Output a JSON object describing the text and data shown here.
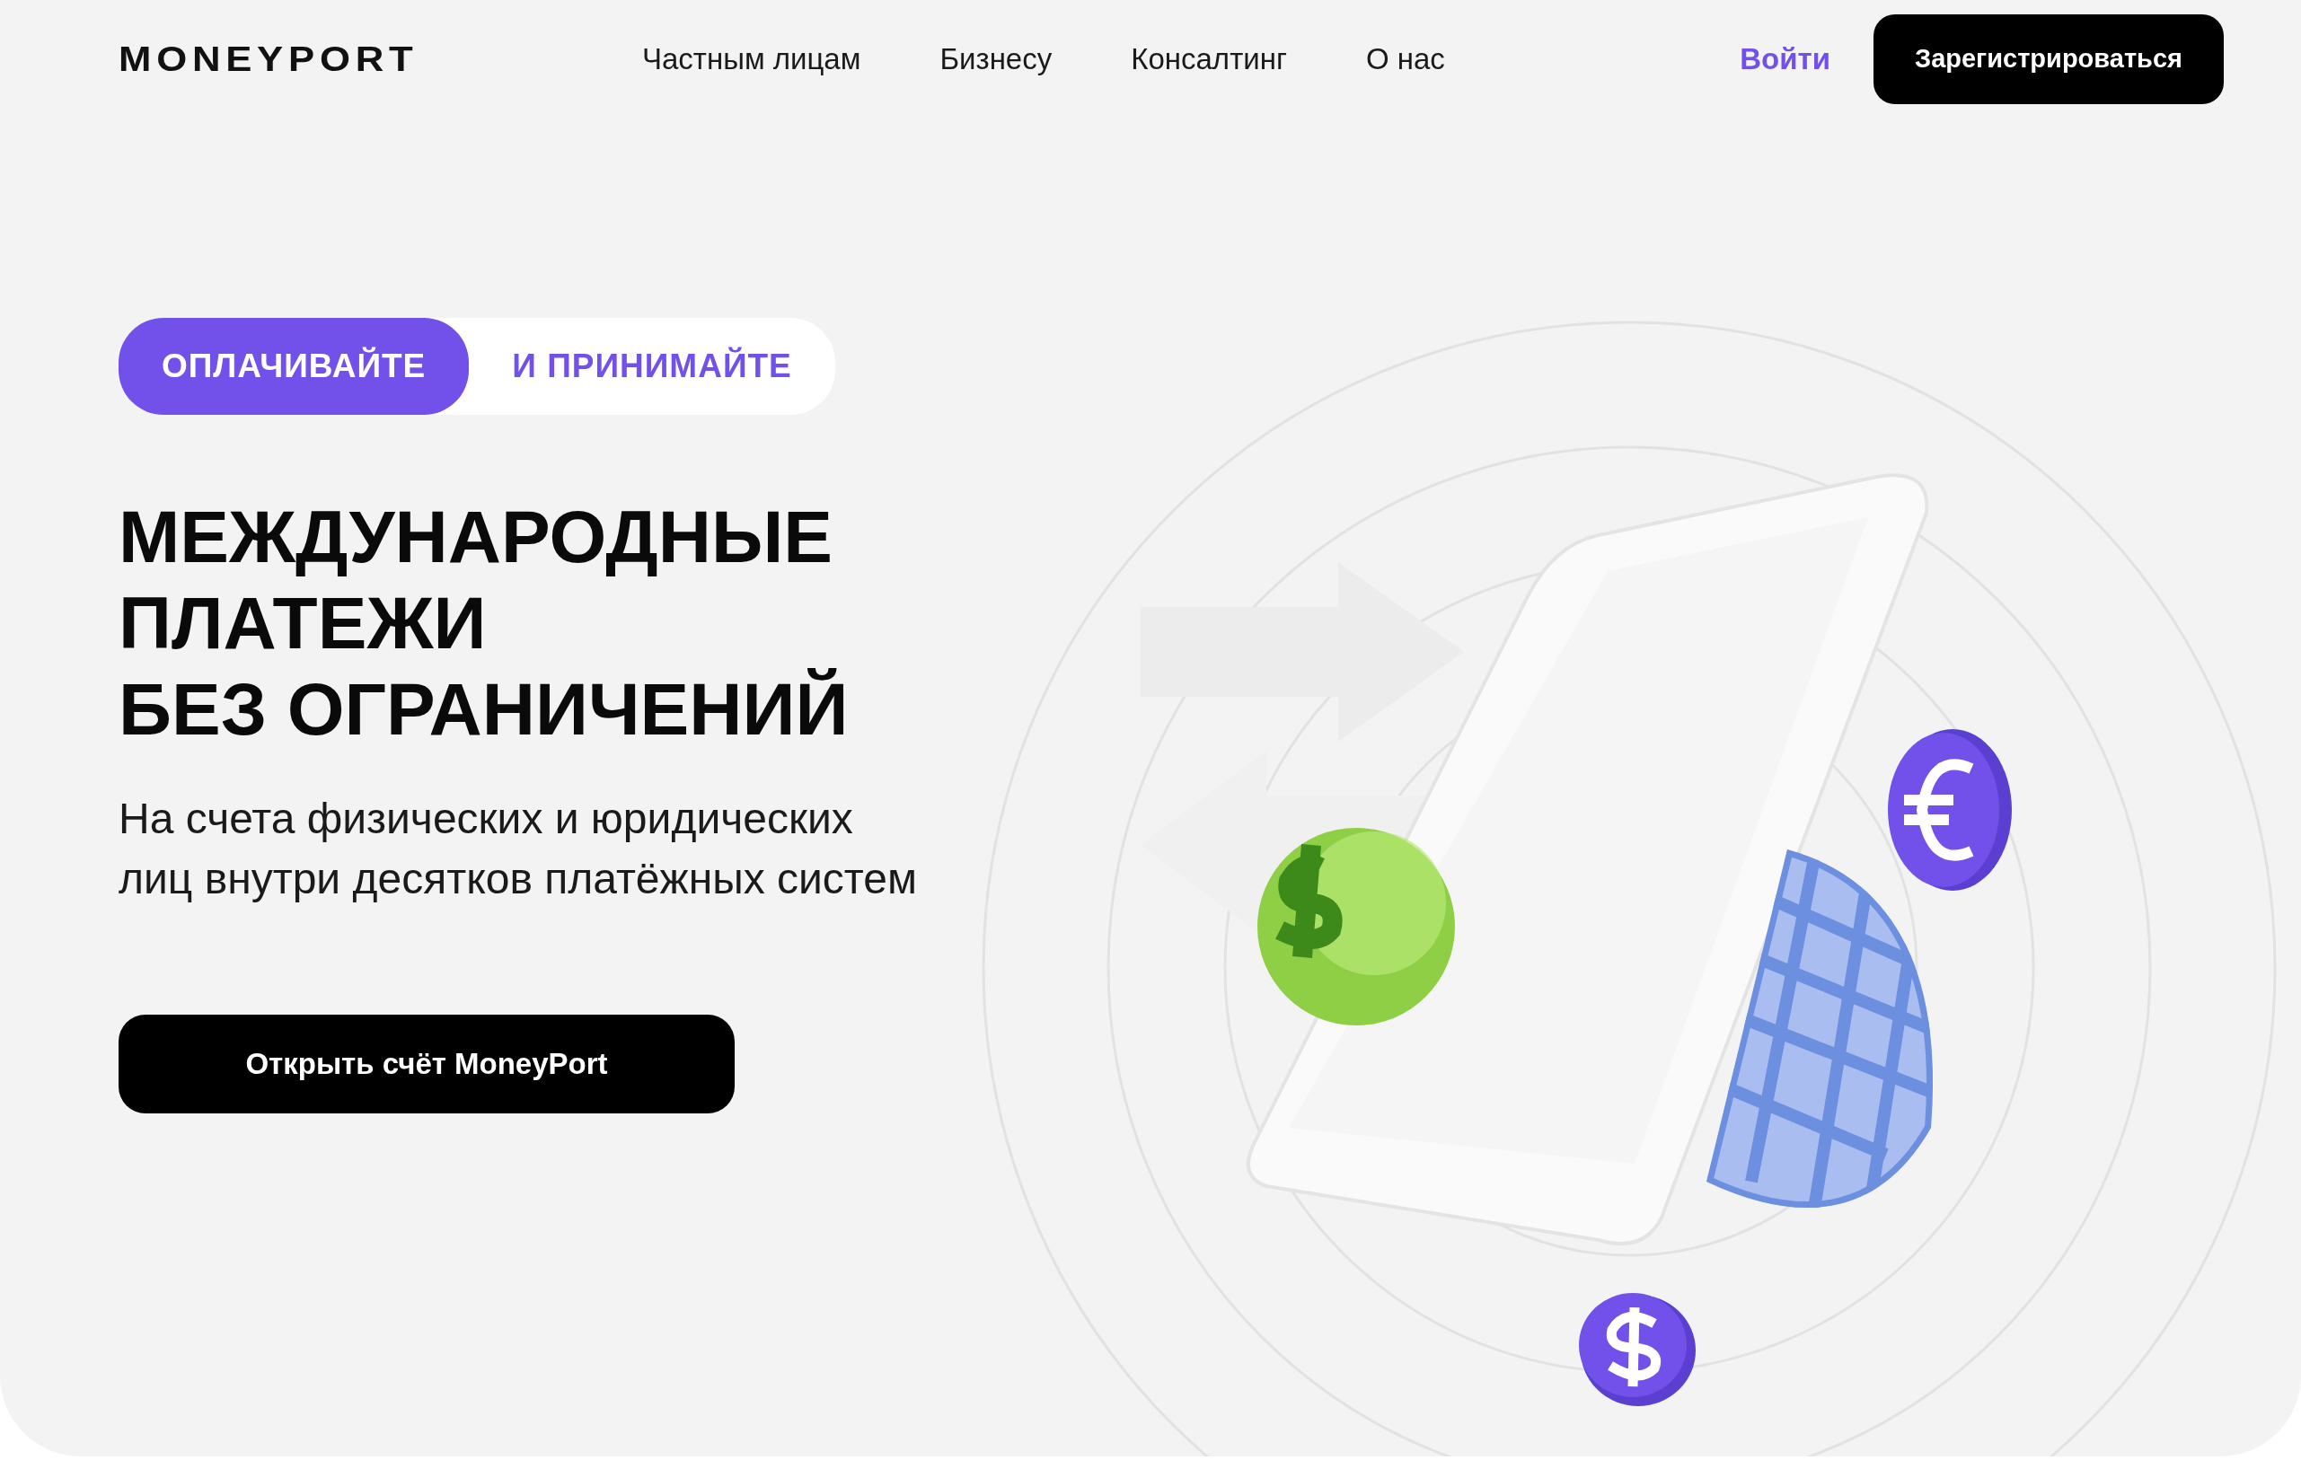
{
  "header": {
    "logo": "MONEYPORT",
    "nav": [
      "Частным лицам",
      "Бизнесу",
      "Консалтинг",
      "О нас"
    ],
    "login": "Войти",
    "register": "Зарегистрироваться"
  },
  "hero": {
    "toggle": [
      {
        "label": "ОПЛАЧИВАЙТЕ",
        "selected": true
      },
      {
        "label": "И ПРИНИМАЙТЕ",
        "selected": false
      }
    ],
    "title_lines": [
      "МЕЖДУНАРОДНЫЕ",
      "ПЛАТЕЖИ",
      "БЕЗ ОГРАНИЧЕНИЙ"
    ],
    "subtitle": "На счета физических и юридических лиц внутри десятков платёжных систем",
    "cta": "Открыть счёт MoneyPort"
  }
}
